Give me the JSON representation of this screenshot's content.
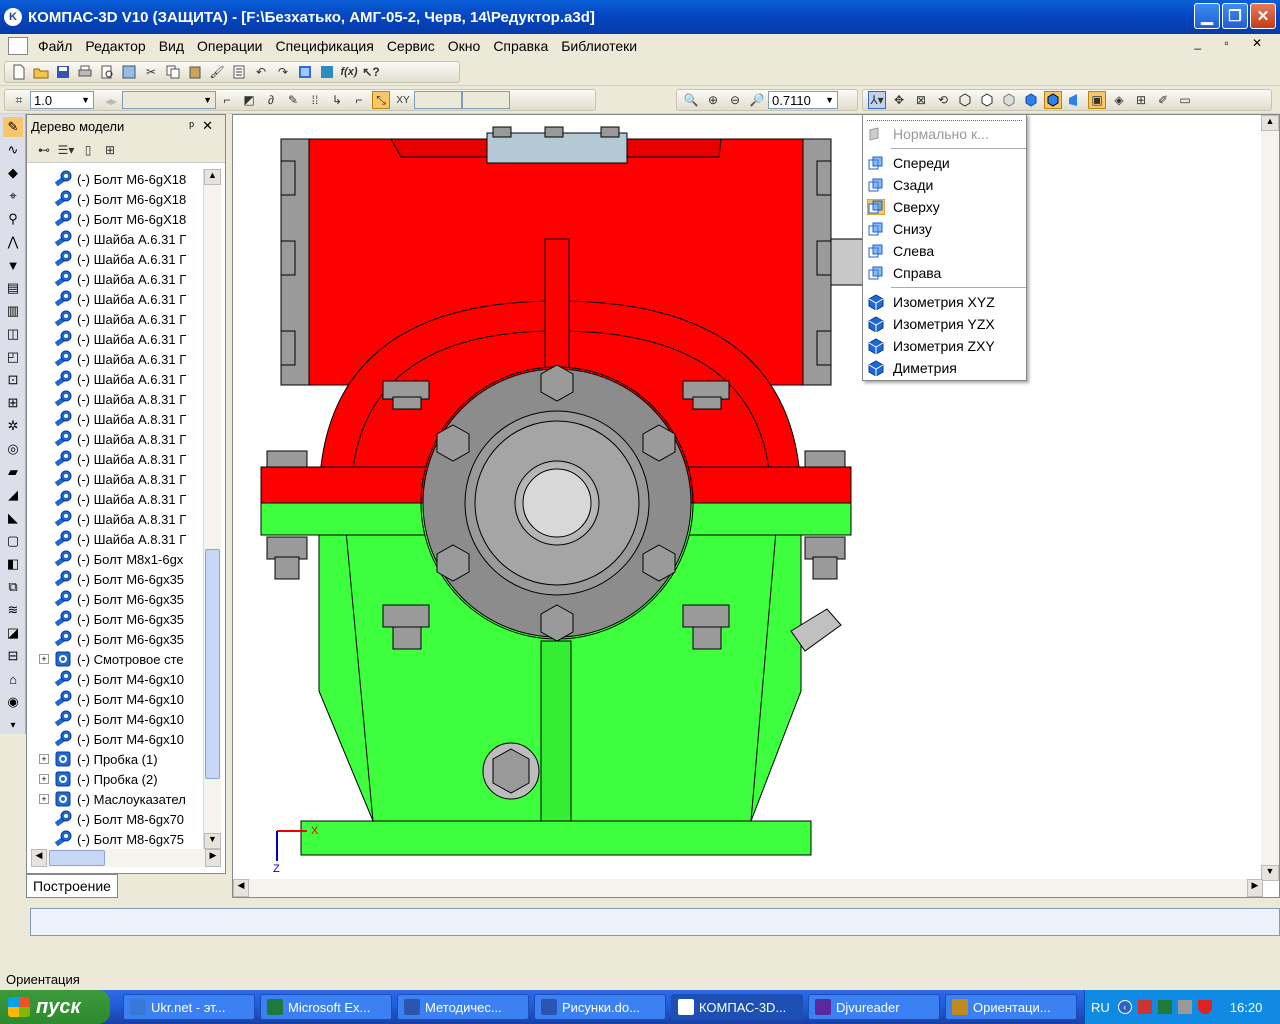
{
  "window": {
    "title": "КОМПАС-3D V10 (ЗАЩИТА) - [F:\\Безхатько, АМГ-05-2, Черв, 14\\Редуктор.a3d]"
  },
  "menu": [
    "Файл",
    "Редактор",
    "Вид",
    "Операции",
    "Спецификация",
    "Сервис",
    "Окно",
    "Справка",
    "Библиотеки"
  ],
  "toolbar": {
    "step_value": "1.0",
    "zoom_value": "0.7110"
  },
  "tree": {
    "title": "Дерево модели",
    "pin": "ᵖ",
    "close": "✕",
    "items": [
      {
        "label": "(-) Болт М6-6gX18",
        "type": "bolt",
        "expand": ""
      },
      {
        "label": "(-) Болт М6-6gX18",
        "type": "bolt",
        "expand": ""
      },
      {
        "label": "(-) Болт М6-6gX18",
        "type": "bolt",
        "expand": ""
      },
      {
        "label": "(-) Шайба А.6.31 Г",
        "type": "bolt",
        "expand": ""
      },
      {
        "label": "(-) Шайба А.6.31 Г",
        "type": "bolt",
        "expand": ""
      },
      {
        "label": "(-) Шайба А.6.31 Г",
        "type": "bolt",
        "expand": ""
      },
      {
        "label": "(-) Шайба А.6.31 Г",
        "type": "bolt",
        "expand": ""
      },
      {
        "label": "(-) Шайба А.6.31 Г",
        "type": "bolt",
        "expand": ""
      },
      {
        "label": "(-) Шайба А.6.31 Г",
        "type": "bolt",
        "expand": ""
      },
      {
        "label": "(-) Шайба А.6.31 Г",
        "type": "bolt",
        "expand": ""
      },
      {
        "label": "(-) Шайба А.6.31 Г",
        "type": "bolt",
        "expand": ""
      },
      {
        "label": "(-) Шайба А.8.31 Г",
        "type": "bolt",
        "expand": ""
      },
      {
        "label": "(-) Шайба А.8.31 Г",
        "type": "bolt",
        "expand": ""
      },
      {
        "label": "(-) Шайба А.8.31 Г",
        "type": "bolt",
        "expand": ""
      },
      {
        "label": "(-) Шайба А.8.31 Г",
        "type": "bolt",
        "expand": ""
      },
      {
        "label": "(-) Шайба А.8.31 Г",
        "type": "bolt",
        "expand": ""
      },
      {
        "label": "(-) Шайба А.8.31 Г",
        "type": "bolt",
        "expand": ""
      },
      {
        "label": "(-) Шайба А.8.31 Г",
        "type": "bolt",
        "expand": ""
      },
      {
        "label": "(-) Шайба А.8.31 Г",
        "type": "bolt",
        "expand": ""
      },
      {
        "label": "(-) Болт М8х1-6gх",
        "type": "bolt",
        "expand": ""
      },
      {
        "label": "(-) Болт М6-6gх35",
        "type": "bolt",
        "expand": ""
      },
      {
        "label": "(-) Болт М6-6gх35",
        "type": "bolt",
        "expand": ""
      },
      {
        "label": "(-) Болт М6-6gх35",
        "type": "bolt",
        "expand": ""
      },
      {
        "label": "(-) Болт М6-6gх35",
        "type": "bolt",
        "expand": ""
      },
      {
        "label": "(-) Смотровое сте",
        "type": "assembly",
        "expand": "+"
      },
      {
        "label": "(-) Болт М4-6gх10",
        "type": "bolt",
        "expand": ""
      },
      {
        "label": "(-) Болт М4-6gх10",
        "type": "bolt",
        "expand": ""
      },
      {
        "label": "(-) Болт М4-6gх10",
        "type": "bolt",
        "expand": ""
      },
      {
        "label": "(-) Болт М4-6gх10",
        "type": "bolt",
        "expand": ""
      },
      {
        "label": "(-) Пробка (1)",
        "type": "assembly",
        "expand": "+"
      },
      {
        "label": "(-) Пробка (2)",
        "type": "assembly",
        "expand": "+"
      },
      {
        "label": "(-) Маслоуказател",
        "type": "assembly",
        "expand": "+"
      },
      {
        "label": "(-) Болт М8-6gх70",
        "type": "bolt",
        "expand": ""
      },
      {
        "label": "(-) Болт М8-6gх75",
        "type": "bolt",
        "expand": ""
      }
    ],
    "tab_label": "Построение"
  },
  "orientation_menu": {
    "disabled_item": "Нормально к...",
    "group1": [
      "Спереди",
      "Сзади",
      "Сверху",
      "Снизу",
      "Слева",
      "Справа"
    ],
    "group2": [
      "Изометрия XYZ",
      "Изометрия YZX",
      "Изометрия ZXY",
      "Диметрия"
    ]
  },
  "axes": {
    "x": "X",
    "z": "Z"
  },
  "status": {
    "text": "Ориентация"
  },
  "taskbar": {
    "start": "пуск",
    "tasks": [
      {
        "label": "Ukr.net - эт...",
        "color": "#3a78d8"
      },
      {
        "label": "Microsoft Ex...",
        "color": "#1d7a3a"
      },
      {
        "label": "Методичес...",
        "color": "#2b55b0"
      },
      {
        "label": "Рисунки.do...",
        "color": "#2b55b0"
      },
      {
        "label": "КОМПАС-3D...",
        "color": "#ffffff"
      },
      {
        "label": "Djvureader",
        "color": "#5a2a9a"
      },
      {
        "label": "Ориентаци...",
        "color": "#c08a20"
      }
    ],
    "lang": "RU",
    "clock": "16:20"
  },
  "colors": {
    "housing_top": "#ff0000",
    "housing_bottom": "#3dff3d",
    "metal": "#a0a0a0"
  }
}
